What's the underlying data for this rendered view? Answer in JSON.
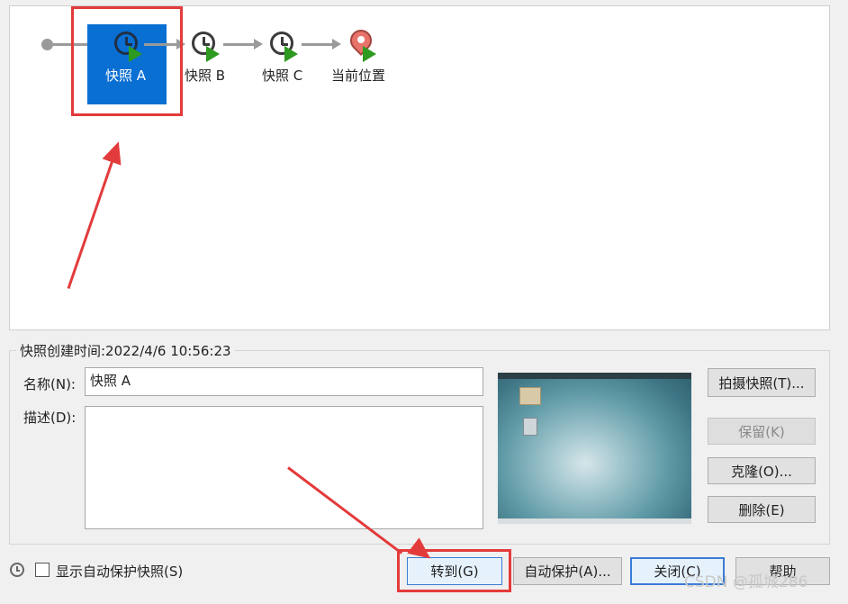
{
  "timeline": {
    "snapshots": [
      {
        "label": "快照 A",
        "selected": true
      },
      {
        "label": "快照 B",
        "selected": false
      },
      {
        "label": "快照 C",
        "selected": false
      }
    ],
    "current_label": "当前位置"
  },
  "details": {
    "created_time": "快照创建时间:2022/4/6 10:56:23",
    "name_label": "名称(N):",
    "name_value": "快照 A",
    "desc_label": "描述(D):",
    "desc_value": ""
  },
  "side_buttons": {
    "take_snapshot": "拍摄快照(T)...",
    "keep": "保留(K)",
    "clone": "克隆(O)...",
    "delete": "删除(E)"
  },
  "footer": {
    "show_auto_label": "显示自动保护快照(S)",
    "goto": "转到(G)",
    "auto_protect": "自动保护(A)...",
    "close": "关闭(C)",
    "help": "帮助"
  },
  "watermark": "CSDN @孤城286",
  "colors": {
    "selection": "#0a6fd3",
    "highlight_red": "#e33b3b",
    "play_green": "#2e9a1f",
    "current_pin": "#e8736b"
  }
}
